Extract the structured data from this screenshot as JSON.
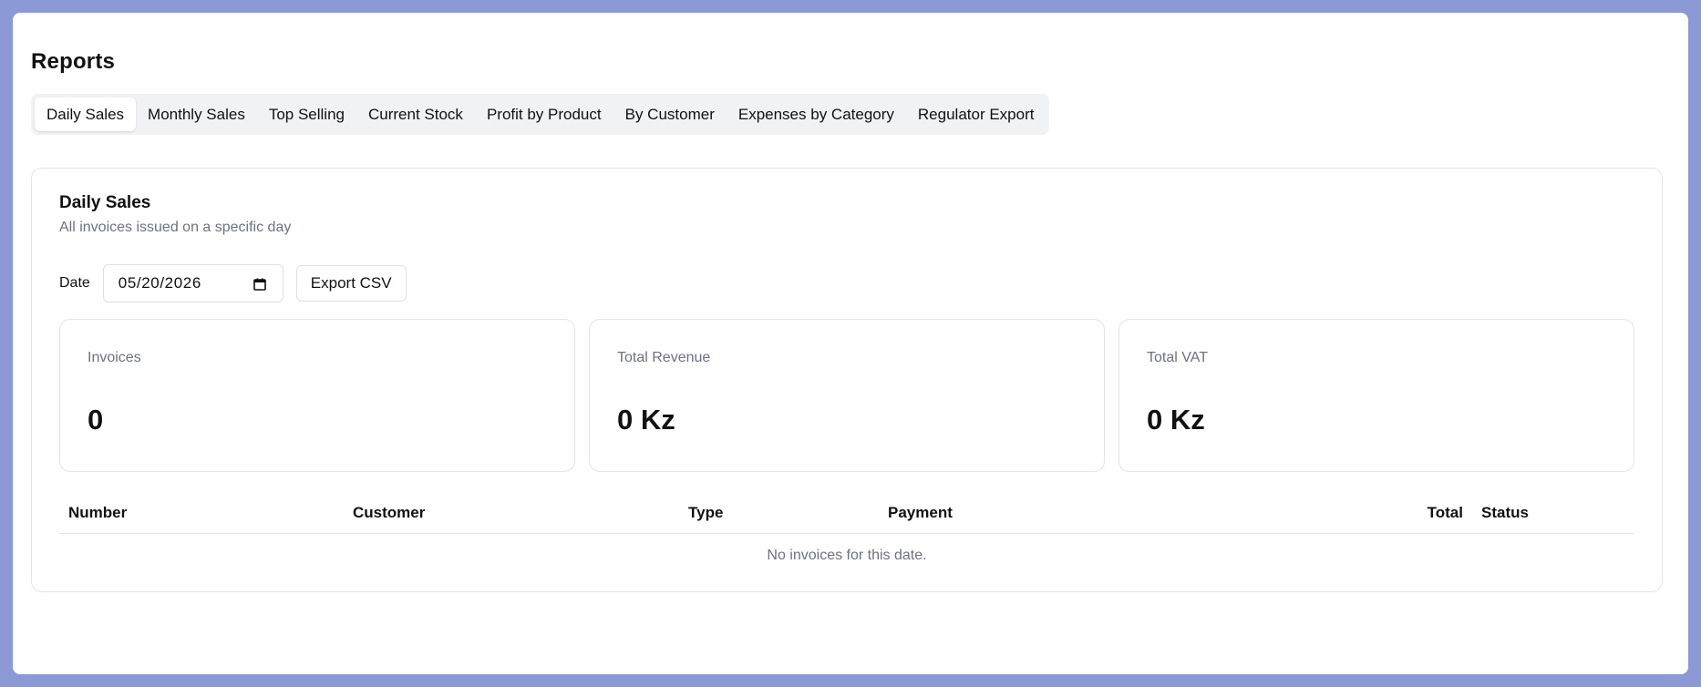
{
  "page": {
    "title": "Reports"
  },
  "tabs": [
    {
      "label": "Daily Sales",
      "active": true
    },
    {
      "label": "Monthly Sales",
      "active": false
    },
    {
      "label": "Top Selling",
      "active": false
    },
    {
      "label": "Current Stock",
      "active": false
    },
    {
      "label": "Profit by Product",
      "active": false
    },
    {
      "label": "By Customer",
      "active": false
    },
    {
      "label": "Expenses by Category",
      "active": false
    },
    {
      "label": "Regulator Export",
      "active": false
    }
  ],
  "section": {
    "title": "Daily Sales",
    "subtitle": "All invoices issued on a specific day"
  },
  "controls": {
    "date_label": "Date",
    "date_value": "05/20/2026",
    "date_icon": "calendar-icon",
    "export_label": "Export CSV"
  },
  "stats": [
    {
      "label": "Invoices",
      "value": "0"
    },
    {
      "label": "Total Revenue",
      "value": "0 Kz"
    },
    {
      "label": "Total VAT",
      "value": "0 Kz"
    }
  ],
  "table": {
    "columns": [
      "Number",
      "Customer",
      "Type",
      "Payment",
      "Total",
      "Status"
    ],
    "empty_message": "No invoices for this date."
  },
  "colors": {
    "background": "#8b9ad6",
    "surface": "#ffffff",
    "tab_track": "#f1f2f4",
    "muted_text": "#6b7280",
    "border": "#e3e5e8"
  }
}
